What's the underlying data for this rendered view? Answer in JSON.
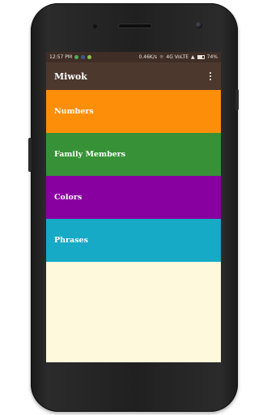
{
  "status_bar": {
    "time": "12:57 PM",
    "speed": "0.46K/s",
    "network": "4G VoLTE",
    "battery": "74%"
  },
  "app_bar": {
    "title": "Miwok",
    "menu_icon": "more-vert-icon"
  },
  "categories": [
    {
      "label": "Numbers",
      "color": "#fd8e09"
    },
    {
      "label": "Family Members",
      "color": "#379237"
    },
    {
      "label": "Colors",
      "color": "#8800a0"
    },
    {
      "label": "Phrases",
      "color": "#16aac6"
    }
  ],
  "colors": {
    "status_bar": "#3f2e26",
    "app_bar": "#4d382e",
    "background": "#fef8dc"
  }
}
